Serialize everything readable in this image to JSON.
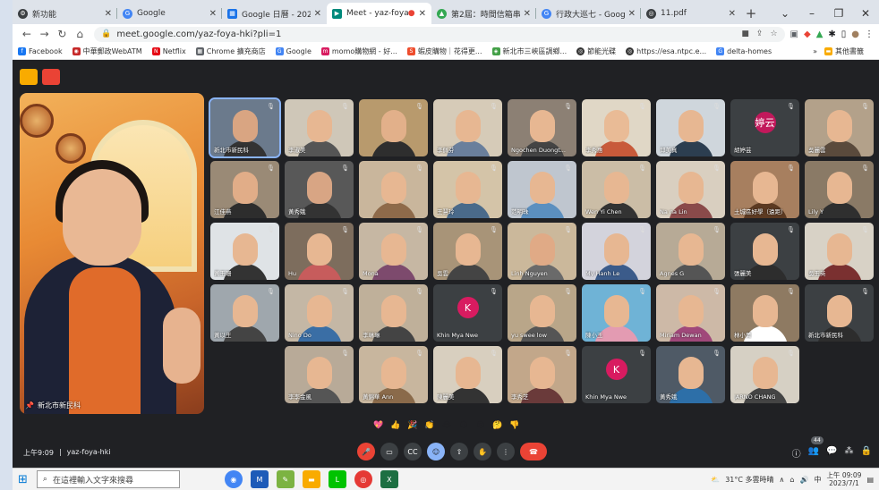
{
  "tabs": [
    {
      "label": "新功能",
      "color": "#3c4043"
    },
    {
      "label": "Google",
      "color": "#4285f4"
    },
    {
      "label": "Google 日曆 - 2023年",
      "color": "#1a73e8"
    },
    {
      "label": "Meet - yaz-foya",
      "color": "#00897b",
      "active": true
    },
    {
      "label": "第2屆：時間信箱串",
      "color": "#34a853"
    },
    {
      "label": "行政大巡七 - Google",
      "color": "#4285f4"
    },
    {
      "label": "11.pdf",
      "color": "#3c4043"
    }
  ],
  "browser": {
    "url": "meet.google.com/yaz-foya-hki?pli=1"
  },
  "bookmarks": [
    "Facebook",
    "中華郵政WebATM",
    "Netflix",
    "Chrome 擴充商店",
    "Google",
    "momo購物網 - 好...",
    "蝦皮購物｜花得更...",
    "新北市三峽區調鄉...",
    "節能光碟",
    "https://esa.ntpc.e...",
    "delta-homes"
  ],
  "bookmarks_other": "其他書籤",
  "speaker": {
    "name": "新北市新民科"
  },
  "tiles": [
    {
      "name": "新北市新民科",
      "bg": "#6b7a8c",
      "skin": "#d9a582",
      "cloth": "#333",
      "pres": true
    },
    {
      "name": "李淑美",
      "bg": "#cfc7b8",
      "skin": "#e7b792",
      "cloth": "#555"
    },
    {
      "name": "",
      "bg": "#b89a6d",
      "skin": "#e2b08a",
      "cloth": "#2e2e2e"
    },
    {
      "name": "李佩芬",
      "bg": "#d6cbb8",
      "skin": "#e7b792",
      "cloth": "#6a7f9c"
    },
    {
      "name": "Ngochen Duongt...",
      "bg": "#8c8074",
      "skin": "#e7b792",
      "cloth": "#444"
    },
    {
      "name": "李秀惠",
      "bg": "#e0d7c6",
      "skin": "#e9bb96",
      "cloth": "#c85a3a"
    },
    {
      "name": "邱美真",
      "bg": "#cfd6dc",
      "skin": "#e7b792",
      "cloth": "#2c3e50"
    },
    {
      "name": "胡婷芸",
      "bg": "#3c4043",
      "avatar": "婷云",
      "avcolor": "#c2185b"
    },
    {
      "name": "吳麗雲",
      "bg": "#b3a18a",
      "skin": "#e7b792",
      "cloth": "#5a4a3c"
    },
    {
      "name": "江佳燕",
      "bg": "#9a8a76",
      "skin": "#e1ad88",
      "cloth": "#2d2d2d"
    },
    {
      "name": "黃秀娥",
      "bg": "#585858",
      "skin": "#d8a584",
      "cloth": "#333"
    },
    {
      "name": "",
      "bg": "#c9b69c",
      "skin": "#e7b792",
      "cloth": "#8e6a4a"
    },
    {
      "name": "王慧玲",
      "bg": "#d4c4a8",
      "skin": "#e7b792",
      "cloth": "#4a6a8a"
    },
    {
      "name": "范明珠",
      "bg": "#bfc6cf",
      "skin": "#e7b792",
      "cloth": "#5b8fbf"
    },
    {
      "name": "Wen Yi Chen",
      "bg": "#cbbda6",
      "skin": "#e7b792",
      "cloth": "#333"
    },
    {
      "name": "Na na Lin",
      "bg": "#d9cfc0",
      "skin": "#e7b792",
      "cloth": "#8a4a4a"
    },
    {
      "name": "土城區好學（遠距）",
      "bg": "#a77f5f",
      "skin": "#e7b792",
      "cloth": "#5c3a22"
    },
    {
      "name": "Lily Y",
      "bg": "#8a7a66",
      "skin": "#e7b792",
      "cloth": "#2f2f2f"
    },
    {
      "name": "黃玉珊",
      "bg": "#dfe3e6",
      "skin": "#e7b792",
      "cloth": "#333"
    },
    {
      "name": "Hu",
      "bg": "#7d6d5d",
      "skin": "#e7b792",
      "cloth": "#c75c5c"
    },
    {
      "name": "Mona",
      "bg": "#c6b7a3",
      "skin": "#e7b792",
      "cloth": "#7d4a6d"
    },
    {
      "name": "吳雲",
      "bg": "#a89478",
      "skin": "#e7b792",
      "cloth": "#444"
    },
    {
      "name": "Linh Nguyen",
      "bg": "#cbb89b",
      "skin": "#e0aa86",
      "cloth": "#6a6a6a"
    },
    {
      "name": "My Hanh Le",
      "bg": "#d3d3dc",
      "skin": "#e7b792",
      "cloth": "#3b5b8a"
    },
    {
      "name": "Agnes G",
      "bg": "#b7aa96",
      "skin": "#e7b792",
      "cloth": "#555"
    },
    {
      "name": "張麗美",
      "bg": "#3c4043",
      "skin": "#e7b792",
      "cloth": "#2d2d2d"
    },
    {
      "name": "吳玉英",
      "bg": "#d8d2c6",
      "skin": "#e7b792",
      "cloth": "#7a3030"
    },
    {
      "name": "黃以王",
      "bg": "#9fa7ad",
      "skin": "#e7b792",
      "cloth": "#444"
    },
    {
      "name": "Nino Do",
      "bg": "#c4b7a5",
      "skin": "#e7b792",
      "cloth": "#3a6ea5"
    },
    {
      "name": "李琳琳",
      "bg": "#bfb09a",
      "skin": "#e7b792",
      "cloth": "#444"
    },
    {
      "name": "Khin Mya Nwe",
      "bg": "#3c4043",
      "avatar": "K",
      "avcolor": "#d81b60"
    },
    {
      "name": "yu swee low",
      "bg": "#b9a689",
      "skin": "#e7b792",
      "cloth": "#555"
    },
    {
      "name": "陳小玉",
      "bg": "#6fb3d6",
      "skin": "#e7b792",
      "cloth": "#e39bb2"
    },
    {
      "name": "Miriam Dewan",
      "bg": "#cdb9a7",
      "skin": "#e7b792",
      "cloth": "#a0487a"
    },
    {
      "name": "林小菁",
      "bg": "#8e7a62",
      "skin": "#e7b792",
      "cloth": "#fff"
    },
    {
      "name": "新北市新民科",
      "bg": "#3c4043",
      "skin": "#e7b792",
      "cloth": "#2d2d2d"
    },
    {
      "name": "李李金風",
      "bg": "#b8aa98",
      "skin": "#e7b792",
      "cloth": "#555"
    },
    {
      "name": "黃錦華 Ann",
      "bg": "#c8b69e",
      "skin": "#e7b792",
      "cloth": "#8a6a4a"
    },
    {
      "name": "陳麗美",
      "bg": "#d8cfbf",
      "skin": "#e7b792",
      "cloth": "#333"
    },
    {
      "name": "李秀芝",
      "bg": "#c2a78a",
      "skin": "#e7b792",
      "cloth": "#6a3a3a"
    },
    {
      "name": "Khin Mya Nwe",
      "bg": "#3c4043",
      "avatar": "K",
      "avcolor": "#d81b60"
    },
    {
      "name": "黃秀娥",
      "bg": "#4f5a66",
      "skin": "#e7b792",
      "cloth": "#2d6fa8"
    },
    {
      "name": "JARNO CHANG",
      "bg": "#d6d0c4",
      "skin": "#e7b792",
      "cloth": "#444"
    }
  ],
  "reactions": [
    "💖",
    "👍",
    "🎉",
    "👏",
    "😂",
    "😮",
    "😢",
    "🤔",
    "👎"
  ],
  "meeting": {
    "time": "上午9:09",
    "code": "yaz-foya-hki",
    "participants": "44"
  },
  "taskbar": {
    "search": "在這裡輸入文字來搜尋",
    "weather": "31°C 多雲時晴",
    "time": "上午 09:09",
    "date": "2023/7/1"
  }
}
